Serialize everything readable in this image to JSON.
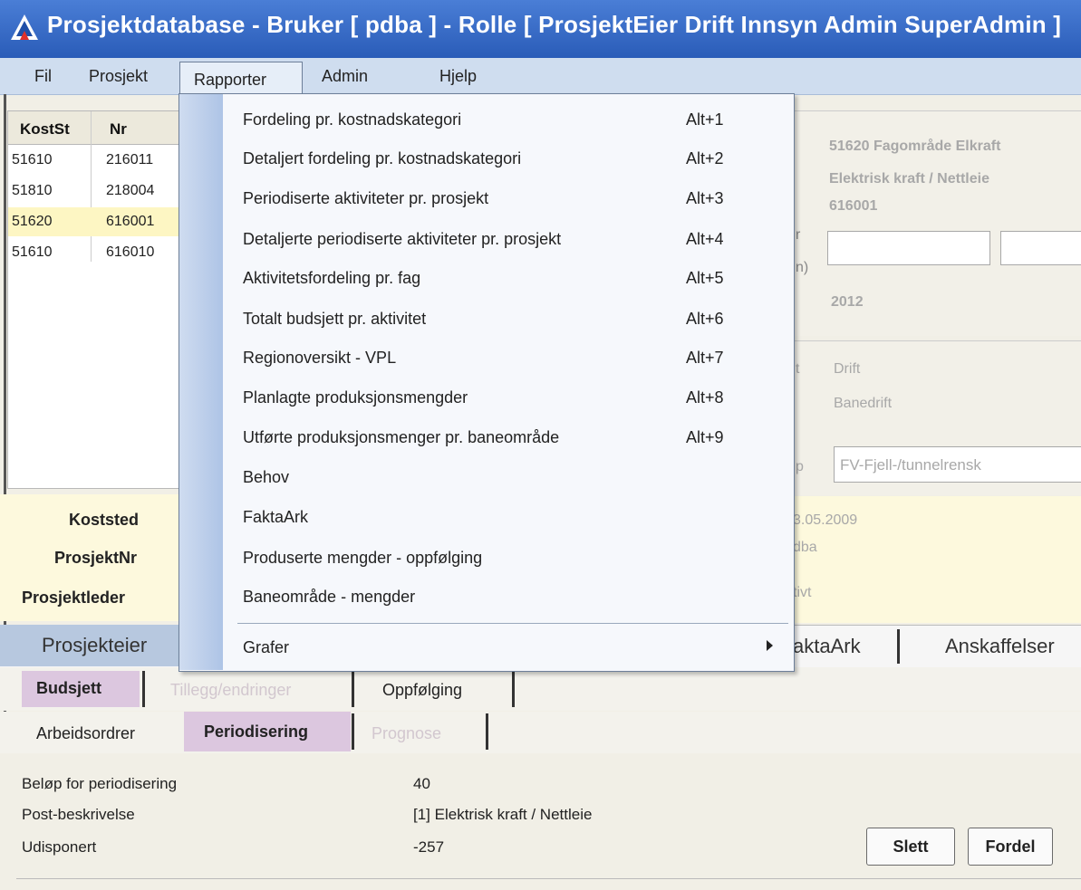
{
  "window": {
    "title": "Prosjektdatabase  -  Bruker [ pdba ]  -  Rolle [ ProsjektEier Drift Innsyn Admin SuperAdmin ]"
  },
  "menubar": {
    "fil": "Fil",
    "prosjekt": "Prosjekt",
    "rapporter": "Rapporter",
    "admin": "Admin",
    "hjelp": "Hjelp"
  },
  "grid": {
    "headers": [
      "KostSt",
      "Nr"
    ],
    "rows": [
      [
        "51610",
        "216011"
      ],
      [
        "51810",
        "218004"
      ],
      [
        "51620",
        "616001"
      ],
      [
        "51610",
        "616010"
      ]
    ]
  },
  "info": {
    "koststed": "Koststed",
    "prosjektnr": "ProsjektNr",
    "prosjektleder": "Prosjektleder"
  },
  "right": {
    "line1": "51620  Fagområde Elkraft",
    "line2": "Elektrisk kraft / Nettleie",
    "line3": "616001",
    "frag_n": "n)",
    "frag_r": "r",
    "year": "2012",
    "frag_t": "t",
    "drift": "Drift",
    "banedrift": "Banedrift",
    "frag_p": "p",
    "select_value": "FV-Fjell-/tunnelrensk",
    "date": "3.05.2009",
    "user": "dba",
    "status": "tivt"
  },
  "tabs": {
    "prosjekteier": "Prosjekteier",
    "faktaark": "aktaArk",
    "anskaffelser": "Anskaffelser"
  },
  "subtabs1": {
    "budsjett": "Budsjett",
    "tillegg": "Tillegg/endringer",
    "oppfolging": "Oppfølging"
  },
  "subtabs2": {
    "arbeidsordrer": "Arbeidsordrer",
    "periodisering": "Periodisering",
    "prognose": "Prognose"
  },
  "detail": {
    "belop_label": "Beløp for periodisering",
    "belop_value": "40",
    "post_label": "Post-beskrivelse",
    "post_value": "[1] Elektrisk kraft / Nettleie",
    "udisponert_label": "Udisponert",
    "udisponert_value": "-257",
    "slett": "Slett",
    "fordel": "Fordel"
  },
  "dropdown": {
    "items": [
      {
        "label": "Fordeling pr. kostnadskategori",
        "shortcut": "Alt+1"
      },
      {
        "label": "Detaljert fordeling pr. kostnadskategori",
        "shortcut": "Alt+2"
      },
      {
        "label": "Periodiserte aktiviteter pr. prosjekt",
        "shortcut": "Alt+3"
      },
      {
        "label": "Detaljerte periodiserte aktiviteter pr. prosjekt",
        "shortcut": "Alt+4"
      },
      {
        "label": "Aktivitetsfordeling pr. fag",
        "shortcut": "Alt+5"
      },
      {
        "label": "Totalt budsjett pr. aktivitet",
        "shortcut": "Alt+6"
      },
      {
        "label": "Regionoversikt - VPL",
        "shortcut": "Alt+7"
      },
      {
        "label": "Planlagte produksjonsmengder",
        "shortcut": "Alt+8"
      },
      {
        "label": "Utførte produksjonsmenger pr. baneområde",
        "shortcut": "Alt+9"
      },
      {
        "label": "Behov",
        "shortcut": ""
      },
      {
        "label": "FaktaArk",
        "shortcut": ""
      },
      {
        "label": "Produserte mengder - oppfølging",
        "shortcut": ""
      },
      {
        "label": "Baneområde - mengder",
        "shortcut": ""
      }
    ],
    "grafer": "Grafer"
  },
  "icons": {
    "app": "app-logo-icon",
    "submenu": "submenu-arrow-icon"
  }
}
